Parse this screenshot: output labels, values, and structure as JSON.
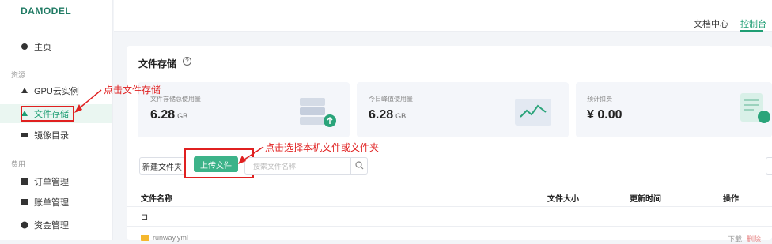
{
  "app": {
    "logo": "DAMODEL"
  },
  "header": {
    "links": [
      "文档中心",
      "控制台"
    ],
    "active": "控制台"
  },
  "sidebar": {
    "home": "主页",
    "section_resource": "资源",
    "items_resource": [
      "GPU云实例",
      "文件存储",
      "镜像目录"
    ],
    "section_billing": "费用",
    "items_billing": [
      "订单管理",
      "账单管理",
      "资金管理"
    ],
    "active": "文件存储"
  },
  "page": {
    "title": "文件存储",
    "help": "?",
    "cards": [
      {
        "label": "文件存储总使用量",
        "value": "6.28",
        "unit": "GB"
      },
      {
        "label": "今日峰值使用量",
        "value": "6.28",
        "unit": "GB"
      },
      {
        "label": "预计扣费",
        "value": "¥ 0.00",
        "unit": ""
      }
    ]
  },
  "toolbar": {
    "new_folder": "新建文件夹",
    "upload": "上传文件",
    "search_placeholder": "搜索文件名称"
  },
  "table": {
    "headers": [
      "文件名称",
      "文件大小",
      "更新时间",
      "操作"
    ],
    "up_row": "⊐",
    "rows": [
      {
        "name": "runway.yml",
        "ops": [
          "下载",
          "删除"
        ]
      }
    ]
  },
  "annotations": {
    "storage": "点击文件存储",
    "upload": "点击选择本机文件或文件夹"
  },
  "colors": {
    "brand": "#1f9e74",
    "upload_btn": "#3db389",
    "annotation": "#e02020"
  }
}
